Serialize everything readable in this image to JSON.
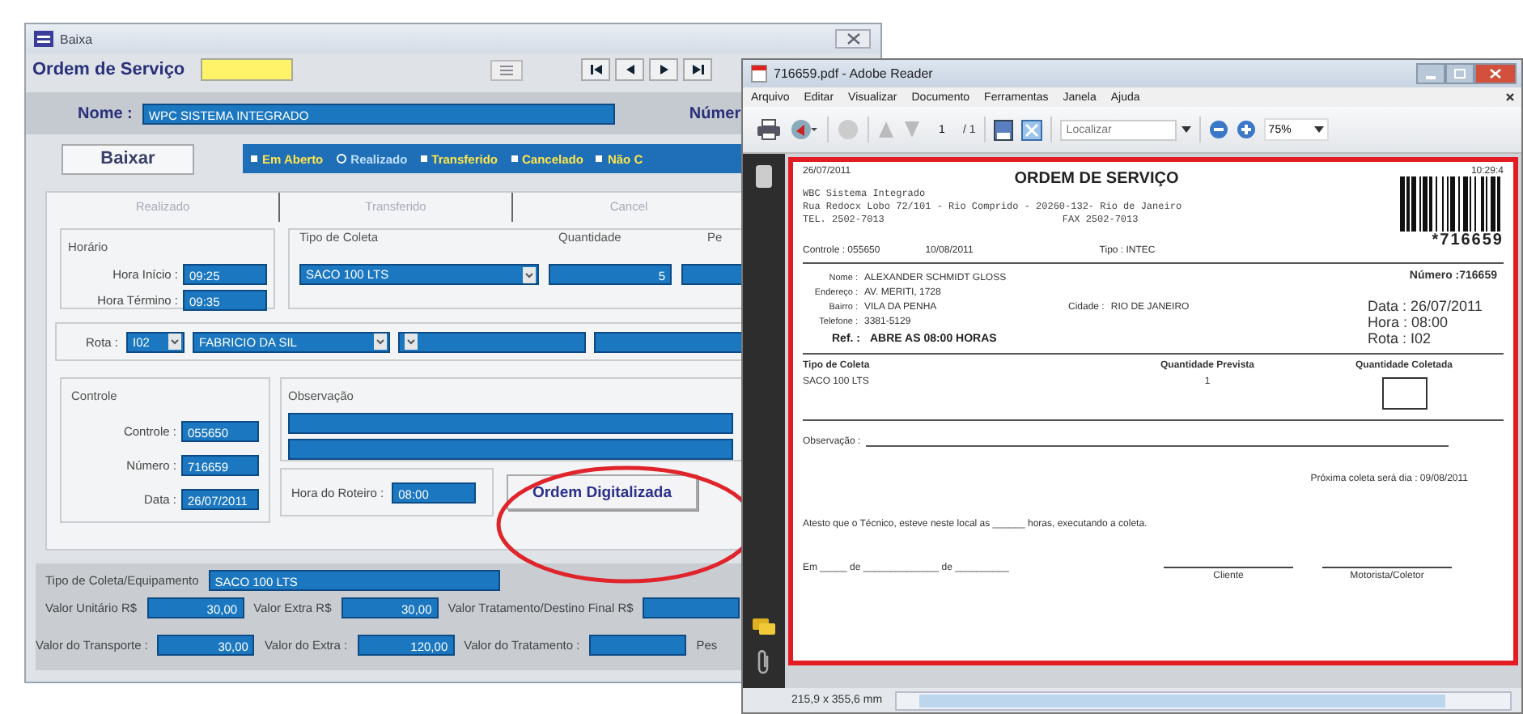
{
  "form_window": {
    "title": "Baixa",
    "ordem_label": "Ordem de Serviço",
    "nome_label": "Nome :",
    "nome_value": "WPC SISTEMA INTEGRADO",
    "numero_label": "Númer",
    "baixar_button": "Baixar",
    "status_options": [
      {
        "label": "Em Aberto",
        "selected": false
      },
      {
        "label": "Realizado",
        "selected": true
      },
      {
        "label": "Transferido",
        "selected": false
      },
      {
        "label": "Cancelado",
        "selected": false
      },
      {
        "label": "Não C",
        "selected": false
      }
    ],
    "tabs": [
      "Realizado",
      "Transferido",
      "Cancel"
    ],
    "horario": {
      "title": "Horário",
      "fields": [
        {
          "label": "Hora Início :",
          "value": "09:25"
        },
        {
          "label": "Hora Término :",
          "value": "09:35"
        }
      ]
    },
    "tipo_coleta": {
      "title": "Tipo de Coleta",
      "value": "SACO 100 LTS",
      "quantidade_label": "Quantidade",
      "quantidade": "5",
      "peso_label": "Pe"
    },
    "rota": {
      "label": "Rota :",
      "code": "I02",
      "name": "FABRICIO DA SIL"
    },
    "controle": {
      "title": "Controle",
      "fields": [
        {
          "label": "Controle :",
          "value": "055650"
        },
        {
          "label": "Número :",
          "value": "716659"
        },
        {
          "label": "Data :",
          "value": "26/07/2011"
        }
      ]
    },
    "observacao_title": "Observação",
    "hora_roteiro": {
      "label": "Hora do Roteiro :",
      "value": "08:00"
    },
    "digitalizada_button": "Ordem Digitalizada",
    "footer": [
      [
        {
          "kind": "field",
          "label": "Tipo de Coleta/Equipamento",
          "value": "SACO 100 LTS"
        }
      ],
      [
        {
          "kind": "field",
          "label": "Valor Unitário R$",
          "value": "30,00"
        },
        {
          "kind": "field",
          "label": "Valor Extra R$",
          "value": "30,00"
        },
        {
          "kind": "field",
          "label": "Valor Tratamento/Destino Final R$"
        }
      ],
      [
        {
          "kind": "field",
          "label": "Valor do Transporte :",
          "value": "30,00"
        },
        {
          "kind": "field",
          "label": "Valor do Extra :",
          "value": "120,00"
        },
        {
          "kind": "field",
          "label": "Valor do Tratamento :"
        },
        {
          "kind": "label",
          "label": "Pes"
        }
      ]
    ]
  },
  "reader": {
    "title": "716659.pdf - Adobe Reader",
    "menu": [
      "Arquivo",
      "Editar",
      "Visualizar",
      "Documento",
      "Ferramentas",
      "Janela",
      "Ajuda"
    ],
    "page": "1",
    "page_total": "/ 1",
    "search_placeholder": "Localizar",
    "zoom": "75%",
    "page_size": "215,9 x 355,6 mm",
    "document": {
      "print_date": "26/07/2011",
      "print_time": "10:29:4",
      "title": "ORDEM DE SERVIÇO",
      "company_lines": [
        "WBC Sistema Integrado",
        "Rua Redocx Lobo 72/101 - Rio Comprido - 20260-132- Rio de Janeiro"
      ],
      "tel": "TEL. 2502-7013",
      "fax": "FAX 2502-7013",
      "barcode_text": "*716659",
      "meta": [
        "Controle : 055650",
        "10/08/2011",
        "Tipo : INTEC"
      ],
      "client": [
        {
          "label": "Nome :",
          "value": "ALEXANDER SCHMIDT GLOSS"
        },
        {
          "label": "Endereço :",
          "value": "AV. MERITI, 1728"
        },
        {
          "label": "Bairro :",
          "value": "VILA DA PENHA"
        },
        {
          "label": "Telefone :",
          "value": "3381-5129"
        }
      ],
      "cidade_label": "Cidade :",
      "cidade": "RIO DE JANEIRO",
      "ref_label": "Ref. :",
      "ref": "ABRE AS 08:00 HORAS",
      "numero": "Número :716659",
      "details": [
        "Data : 26/07/2011",
        "Hora : 08:00",
        "Rota : I02"
      ],
      "item_headers": [
        "Tipo de Coleta",
        "Quantidade Prevista",
        "Quantidade Coletada"
      ],
      "item_row": [
        "SACO 100 LTS",
        "1"
      ],
      "observacao_label": "Observação :",
      "proxima": "Próxima coleta será dia : 09/08/2011",
      "atesto": "Atesto que o Técnico, esteve neste local as ______ horas, executando a coleta.",
      "em": "Em _____ de ______________ de __________",
      "signatures": [
        "Cliente",
        "Motorista/Coletor"
      ]
    }
  }
}
